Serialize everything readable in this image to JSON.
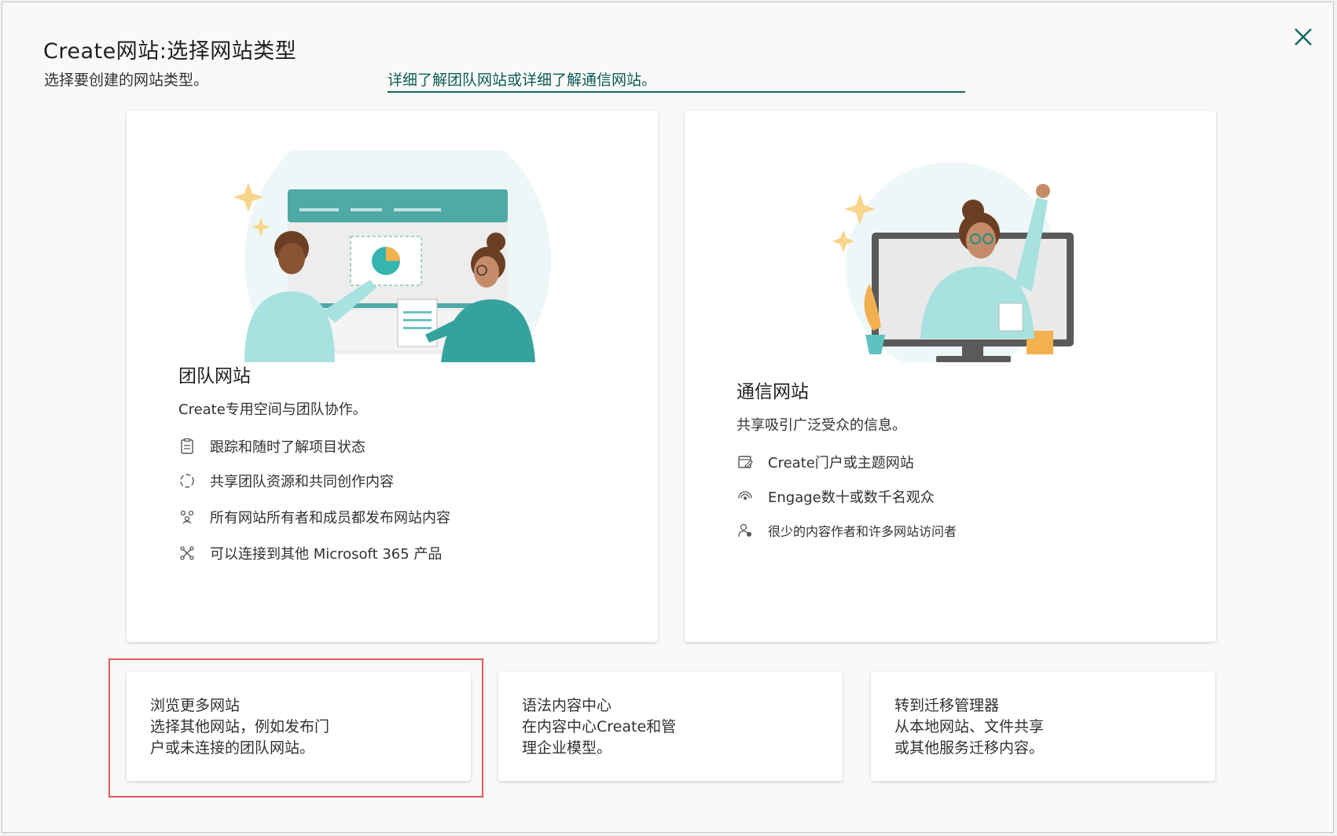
{
  "dialog": {
    "title": "Create网站:选择网站类型",
    "subtitle": "选择要创建的网站类型。",
    "learn_more": "详细了解团队网站或详细了解通信网站。"
  },
  "team_site": {
    "title": "团队网站",
    "description": "Create专用空间与团队协作。",
    "features": [
      {
        "icon": "clipboard-icon",
        "text": "跟踪和随时了解项目状态"
      },
      {
        "icon": "sync-circle-icon",
        "text": "共享团队资源和共同创作内容"
      },
      {
        "icon": "people-icon",
        "text": "所有网站所有者和成员都发布网站内容"
      },
      {
        "icon": "connect-icon",
        "text": "可以连接到其他 Microsoft 365 产品"
      }
    ]
  },
  "comm_site": {
    "title": "通信网站",
    "description": "共享吸引广泛受众的信息。",
    "features": [
      {
        "icon": "edit-page-icon",
        "text": "Create门户或主题网站"
      },
      {
        "icon": "broadcast-icon",
        "text": "Engage数十或数千名观众"
      },
      {
        "icon": "person-group-icon",
        "text": "很少的内容作者和许多网站访问者"
      }
    ]
  },
  "small_cards": [
    {
      "lines": [
        "浏览更多网站",
        "选择其他网站，例如发布门",
        "户或未连接的团队网站。"
      ]
    },
    {
      "lines": [
        "语法内容中心",
        "在内容中心Create和管",
        "理企业模型。"
      ]
    },
    {
      "lines": [
        "转到迁移管理器",
        "从本地网站、文件共享",
        "或其他服务迁移内容。"
      ]
    }
  ],
  "colors": {
    "accent": "#0b6a62",
    "highlight": "#e05a5f"
  }
}
